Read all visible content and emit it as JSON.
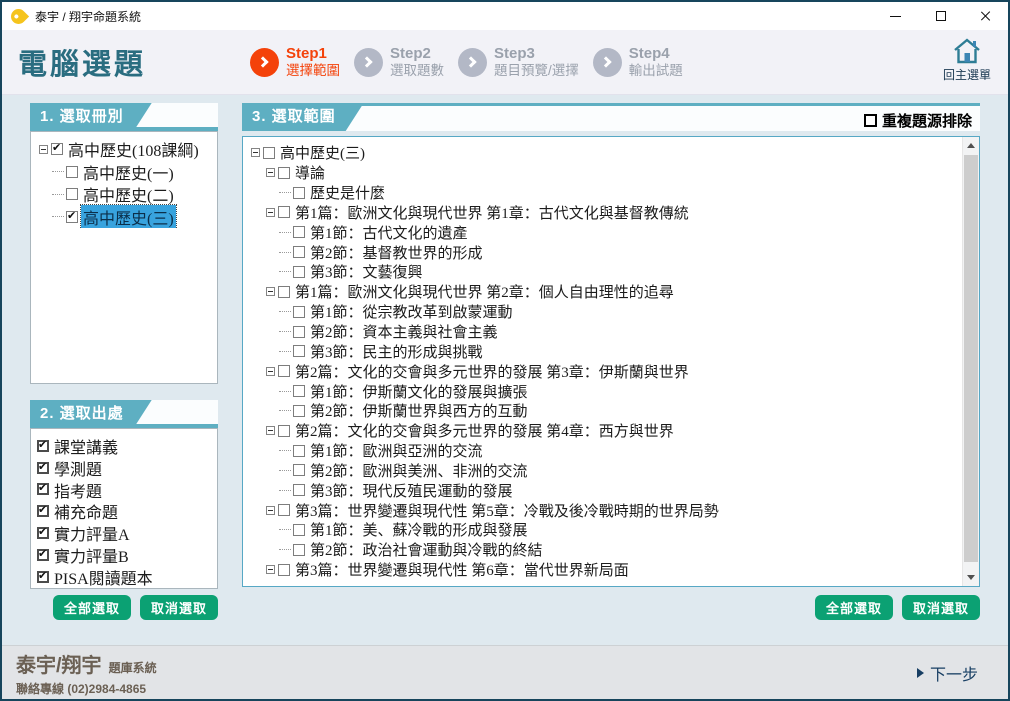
{
  "window": {
    "title": "泰宇 / 翔宇命題系統"
  },
  "header": {
    "title": "電腦選題",
    "steps": [
      {
        "step": "Step1",
        "label": "選擇範圍",
        "active": true
      },
      {
        "step": "Step2",
        "label": "選取題數",
        "active": false
      },
      {
        "step": "Step3",
        "label": "題目預覽/選擇",
        "active": false
      },
      {
        "step": "Step4",
        "label": "輸出試題",
        "active": false
      }
    ],
    "home_label": "回主選單"
  },
  "panels": {
    "volume": {
      "title": "1. 選取冊別",
      "tree": [
        {
          "label": "高中歷史(108課綱)",
          "depth": 0,
          "expander": true,
          "checked": true,
          "selected": false
        },
        {
          "label": "高中歷史(一)",
          "depth": 1,
          "expander": false,
          "checked": false,
          "selected": false
        },
        {
          "label": "高中歷史(二)",
          "depth": 1,
          "expander": false,
          "checked": false,
          "selected": false
        },
        {
          "label": "高中歷史(三)",
          "depth": 1,
          "expander": false,
          "checked": true,
          "selected": true
        }
      ]
    },
    "source": {
      "title": "2. 選取出處",
      "items": [
        {
          "label": "課堂講義",
          "checked": true
        },
        {
          "label": "學測題",
          "checked": true
        },
        {
          "label": "指考題",
          "checked": true
        },
        {
          "label": "補充命題",
          "checked": true
        },
        {
          "label": "實力評量A",
          "checked": true
        },
        {
          "label": "實力評量B",
          "checked": true
        },
        {
          "label": "PISA閱讀題本",
          "checked": true
        }
      ]
    },
    "scope": {
      "title": "3. 選取範圍",
      "exclude_label": "重複題源排除",
      "exclude_checked": false,
      "tree": [
        {
          "label": "高中歷史(三)",
          "depth": 0,
          "expander": true,
          "checked": false
        },
        {
          "label": "導論",
          "depth": 1,
          "expander": true,
          "checked": false
        },
        {
          "label": "歷史是什麼",
          "depth": 2,
          "expander": false,
          "checked": false
        },
        {
          "label": "第1篇：歐洲文化與現代世界 第1章：古代文化與基督教傳統",
          "depth": 1,
          "expander": true,
          "checked": false
        },
        {
          "label": "第1節：古代文化的遺產",
          "depth": 2,
          "expander": false,
          "checked": false
        },
        {
          "label": "第2節：基督教世界的形成",
          "depth": 2,
          "expander": false,
          "checked": false
        },
        {
          "label": "第3節：文藝復興",
          "depth": 2,
          "expander": false,
          "checked": false
        },
        {
          "label": "第1篇：歐洲文化與現代世界 第2章：個人自由理性的追尋",
          "depth": 1,
          "expander": true,
          "checked": false
        },
        {
          "label": "第1節：從宗教改革到啟蒙運動",
          "depth": 2,
          "expander": false,
          "checked": false
        },
        {
          "label": "第2節：資本主義與社會主義",
          "depth": 2,
          "expander": false,
          "checked": false
        },
        {
          "label": "第3節：民主的形成與挑戰",
          "depth": 2,
          "expander": false,
          "checked": false
        },
        {
          "label": "第2篇：文化的交會與多元世界的發展 第3章：伊斯蘭與世界",
          "depth": 1,
          "expander": true,
          "checked": false
        },
        {
          "label": "第1節：伊斯蘭文化的發展與擴張",
          "depth": 2,
          "expander": false,
          "checked": false
        },
        {
          "label": "第2節：伊斯蘭世界與西方的互動",
          "depth": 2,
          "expander": false,
          "checked": false
        },
        {
          "label": "第2篇：文化的交會與多元世界的發展 第4章：西方與世界",
          "depth": 1,
          "expander": true,
          "checked": false
        },
        {
          "label": "第1節：歐洲與亞洲的交流",
          "depth": 2,
          "expander": false,
          "checked": false
        },
        {
          "label": "第2節：歐洲與美洲、非洲的交流",
          "depth": 2,
          "expander": false,
          "checked": false
        },
        {
          "label": "第3節：現代反殖民運動的發展",
          "depth": 2,
          "expander": false,
          "checked": false
        },
        {
          "label": "第3篇：世界變遷與現代性 第5章：冷戰及後冷戰時期的世界局勢",
          "depth": 1,
          "expander": true,
          "checked": false
        },
        {
          "label": "第1節：美、蘇冷戰的形成與發展",
          "depth": 2,
          "expander": false,
          "checked": false
        },
        {
          "label": "第2節：政治社會運動與冷戰的終結",
          "depth": 2,
          "expander": false,
          "checked": false
        },
        {
          "label": "第3篇：世界變遷與現代性 第6章：當代世界新局面",
          "depth": 1,
          "expander": true,
          "checked": false
        }
      ]
    }
  },
  "buttons": {
    "select_all": "全部選取",
    "deselect_all": "取消選取"
  },
  "footer": {
    "brand": "泰宇/翔宇",
    "brand_suffix": "題庫系統",
    "contact": "聯絡專線 (02)2984-4865",
    "next_label": "下一步"
  },
  "colors": {
    "accent_teal": "#5eafc2",
    "title_teal": "#2a6d80",
    "step_active": "#f4420a",
    "button_green": "#0ba173",
    "selection_blue": "#38a3de"
  }
}
